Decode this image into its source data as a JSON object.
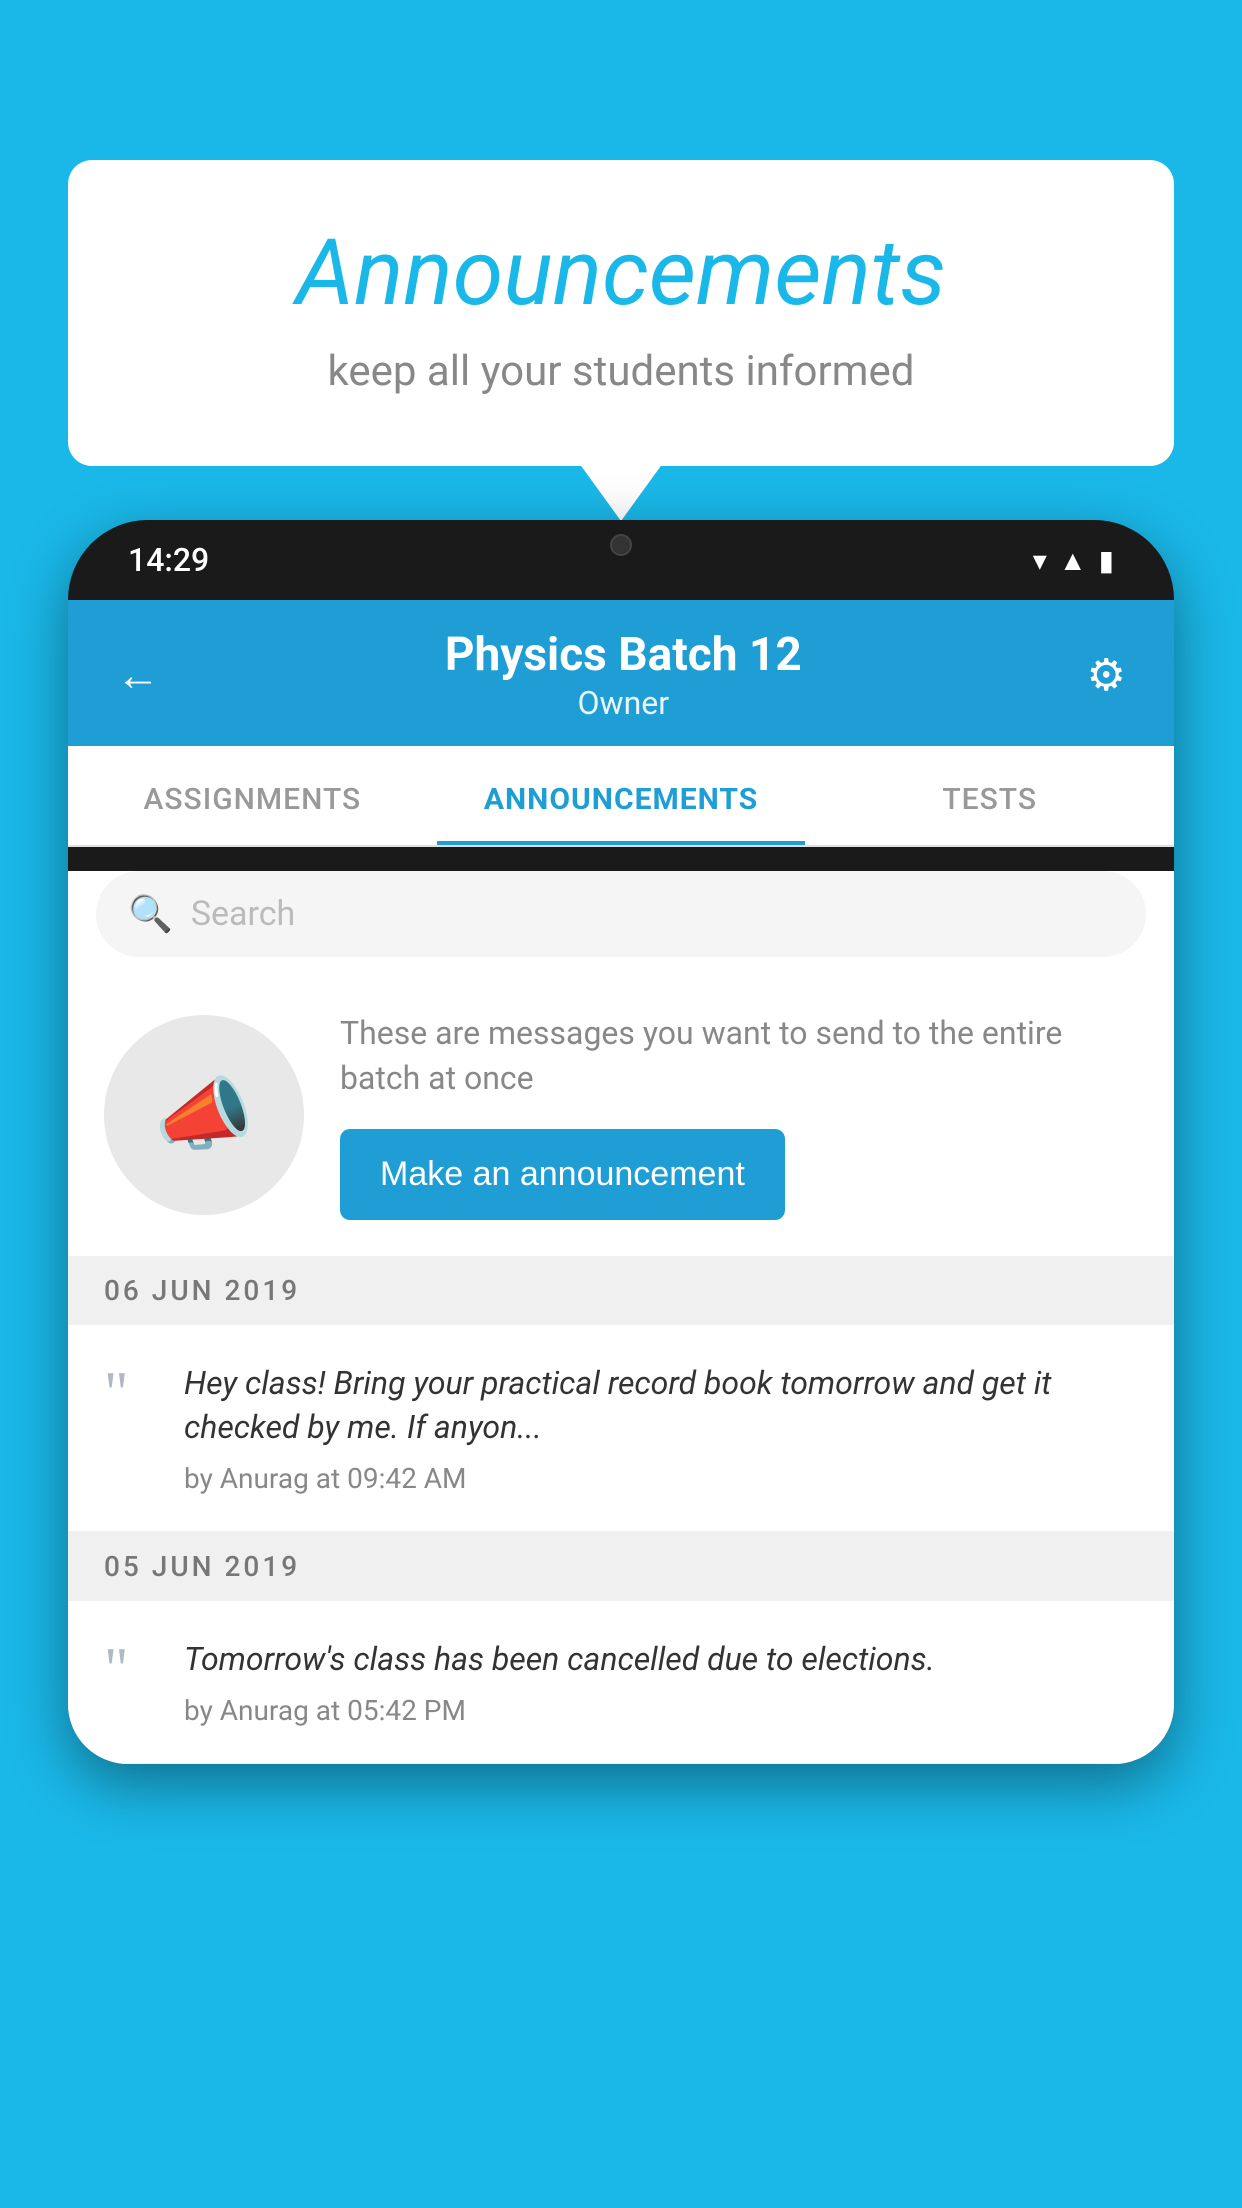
{
  "background_color": "#1ab8e8",
  "speech_bubble": {
    "title": "Announcements",
    "subtitle": "keep all your students informed"
  },
  "phone": {
    "status_bar": {
      "time": "14:29"
    },
    "header": {
      "title": "Physics Batch 12",
      "subtitle": "Owner",
      "back_label": "←",
      "gear_label": "⚙"
    },
    "tabs": [
      {
        "label": "ASSIGNMENTS",
        "active": false
      },
      {
        "label": "ANNOUNCEMENTS",
        "active": true
      },
      {
        "label": "TESTS",
        "active": false
      }
    ],
    "search": {
      "placeholder": "Search"
    },
    "promo": {
      "text": "These are messages you want to send to the entire batch at once",
      "button_label": "Make an announcement"
    },
    "announcements": [
      {
        "date": "06  JUN  2019",
        "text": "Hey class! Bring your practical record book tomorrow and get it checked by me. If anyon...",
        "meta": "by Anurag at 09:42 AM"
      },
      {
        "date": "05  JUN  2019",
        "text": "Tomorrow's class has been cancelled due to elections.",
        "meta": "by Anurag at 05:42 PM"
      }
    ]
  }
}
